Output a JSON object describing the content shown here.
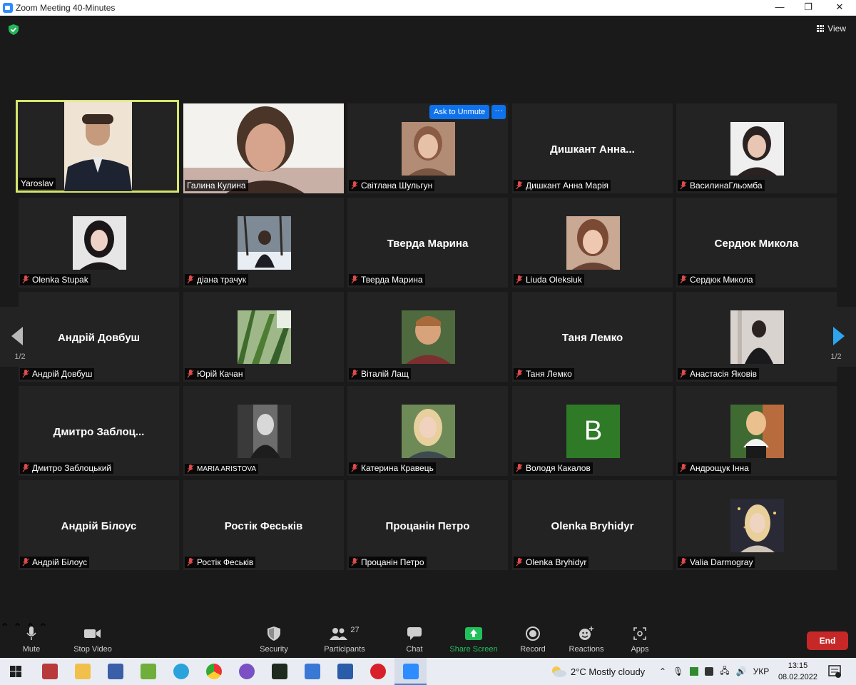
{
  "window": {
    "title": "Zoom Meeting 40-Minutes"
  },
  "stage": {
    "view_label": "View",
    "ask_to_unmute": "Ask to Unmute",
    "more_glyph": "···",
    "page_left": "1/2",
    "page_right": "1/2"
  },
  "tiles": [
    {
      "label": "Yaroslav",
      "big": ""
    },
    {
      "label": "Галина Кулина",
      "big": ""
    },
    {
      "label": "Світлана Шульгун",
      "big": ""
    },
    {
      "label": "Дишкант Анна Марія",
      "big": "Дишкант  Анна..."
    },
    {
      "label": "ВасилинаГльомба",
      "big": ""
    },
    {
      "label": "Olenka Stupak",
      "big": ""
    },
    {
      "label": "діана трачук",
      "big": ""
    },
    {
      "label": "Тверда Марина",
      "big": "Тверда Марина"
    },
    {
      "label": "Liuda Oleksiuk",
      "big": ""
    },
    {
      "label": "Сердюк Микола",
      "big": "Сердюк Микола"
    },
    {
      "label": "Андрій Довбуш",
      "big": "Андрій Довбуш"
    },
    {
      "label": "Юрій Качан",
      "big": ""
    },
    {
      "label": "Віталій Лащ",
      "big": ""
    },
    {
      "label": "Таня Лемко",
      "big": "Таня Лемко"
    },
    {
      "label": "Анастасія Яковів",
      "big": ""
    },
    {
      "label": "Дмитро Заблоцький",
      "big": "Дмитро  Заблоц..."
    },
    {
      "label": "MARIA ARISTOVA",
      "big": ""
    },
    {
      "label": "Катерина Кравець",
      "big": ""
    },
    {
      "label": "Володя Какалов",
      "big": "",
      "avatar_letter": "B"
    },
    {
      "label": "Андрощук Інна",
      "big": ""
    },
    {
      "label": "Андрій Білоус",
      "big": "Андрій Білоус"
    },
    {
      "label": "Ростік Феськів",
      "big": "Ростік Феськів"
    },
    {
      "label": "Процанін Петро",
      "big": "Процанін Петро"
    },
    {
      "label": "Olenka Bryhidyr",
      "big": "Olenka Bryhidyr"
    },
    {
      "label": "Valia Darmogray",
      "big": ""
    }
  ],
  "toolbar": {
    "mute": "Mute",
    "stop_video": "Stop Video",
    "security": "Security",
    "participants": "Participants",
    "participants_count": "27",
    "chat": "Chat",
    "share_screen": "Share Screen",
    "record": "Record",
    "reactions": "Reactions",
    "apps": "Apps",
    "end": "End"
  },
  "taskbar": {
    "weather": "2°C  Mostly cloudy",
    "lang": "УКР",
    "time": "13:15",
    "date": "08.02.2022"
  },
  "colors": {
    "accent": "#0e72ed",
    "speaker": "#d6e56b",
    "end": "#c62828",
    "share": "#22c05c"
  }
}
